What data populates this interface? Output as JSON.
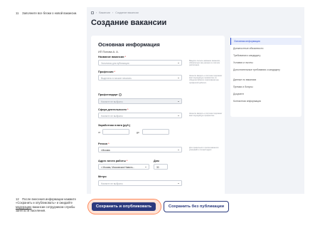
{
  "steps": [
    {
      "num": "11",
      "text": "Заполните все блоки о новой вакансии."
    },
    {
      "num": "12",
      "text_before": "После внесения информации нажмите «Сохранить и опубликовать» и ожидайте ",
      "text_underlined": "модерацию",
      "text_after": " вакансии сотрудником службы занятости населения."
    }
  ],
  "breadcrumb": [
    "Вакансии",
    "Создание вакансии"
  ],
  "page_title": "Создание вакансии",
  "card": {
    "title": "Основная информация",
    "company": "ИП Попова А. А.",
    "vacancy_label": "Название вакансии",
    "vacancy_placeholder": "Заголовок для публикации",
    "vacancy_hint": "Введите полное название вакансии, обязательно как указано в штатном расписании.",
    "profession_label": "Профессия",
    "profession_placeholder": "Выделено в начале печатать",
    "profession_hint": "Начните вводить и система подскажет вам подходящую профессию из общероссийского классификатора профессий рабочих.",
    "profstandard_label": "Профстандарт",
    "profstandard_placeholder": "Начните не выбрано",
    "sphere_label": "Сфера деятельности",
    "sphere_placeholder": "Начните не выбрано",
    "sphere_hint": "Начните вводить и система подскажет вам подходящую профессию.",
    "salary_label": "Заработная плата (руб.)",
    "salary_from": "от",
    "salary_to": "до",
    "region_label": "Регион",
    "region_value": "г.Москва",
    "region_hint": "Для правильного поиска вакансии указывайте полный адрес.",
    "address_label": "Адрес места работы",
    "address_value": "г. Москва, Московская Навиль...",
    "house_label": "Дом",
    "house_value": "30",
    "metro_label": "Метро",
    "metro_placeholder": "Начните не выбрано",
    "required_mark": "*"
  },
  "sidenav": [
    "Основная информация",
    "Должностные обязанности",
    "Требования к кандидату",
    "Условия и льготы",
    "Дополнительные требования к кандидату",
    "Данные по вакансии",
    "Премии и бонусы",
    "Документ",
    "Контактная информация"
  ],
  "buttons": {
    "publish": "Сохранить и опубликовать",
    "save": "Сохранить без публикации"
  },
  "colors": {
    "primary": "#2b3a7e",
    "highlight": "#ff8a5c",
    "accent": "#2a4bd0"
  }
}
